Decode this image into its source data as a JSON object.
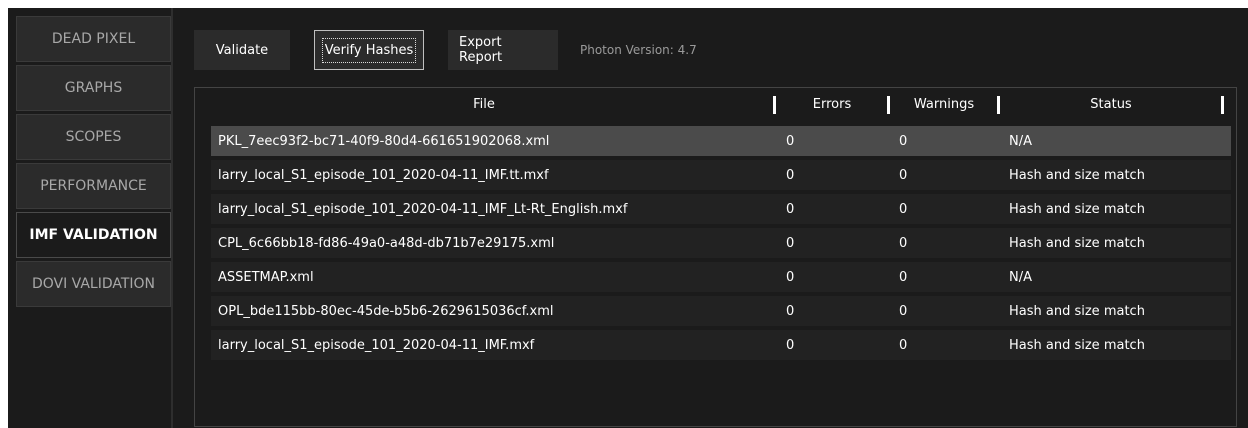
{
  "sidebar": {
    "tabs": [
      {
        "label": "DEAD PIXEL"
      },
      {
        "label": "GRAPHS"
      },
      {
        "label": "SCOPES"
      },
      {
        "label": "PERFORMANCE"
      },
      {
        "label": "IMF VALIDATION"
      },
      {
        "label": "DOVI VALIDATION"
      }
    ],
    "active_tab": "IMF VALIDATION"
  },
  "toolbar": {
    "validate_label": "Validate",
    "verify_hashes_label": "Verify Hashes",
    "export_report_label": "Export Report",
    "photon_version": "Photon Version: 4.7"
  },
  "table": {
    "columns": [
      "File",
      "Errors",
      "Warnings",
      "Status"
    ],
    "rows": [
      {
        "file": "PKL_7eec93f2-bc71-40f9-80d4-661651902068.xml",
        "errors": "0",
        "warnings": "0",
        "status": "N/A"
      },
      {
        "file": "larry_local_S1_episode_101_2020-04-11_IMF.tt.mxf",
        "errors": "0",
        "warnings": "0",
        "status": "Hash and size match"
      },
      {
        "file": "larry_local_S1_episode_101_2020-04-11_IMF_Lt-Rt_English.mxf",
        "errors": "0",
        "warnings": "0",
        "status": "Hash and size match"
      },
      {
        "file": "CPL_6c66bb18-fd86-49a0-a48d-db71b7e29175.xml",
        "errors": "0",
        "warnings": "0",
        "status": "Hash and size match"
      },
      {
        "file": "ASSETMAP.xml",
        "errors": "0",
        "warnings": "0",
        "status": "N/A"
      },
      {
        "file": "OPL_bde115bb-80ec-45de-b5b6-2629615036cf.xml",
        "errors": "0",
        "warnings": "0",
        "status": "Hash and size match"
      },
      {
        "file": "larry_local_S1_episode_101_2020-04-11_IMF.mxf",
        "errors": "0",
        "warnings": "0",
        "status": "Hash and size match"
      }
    ],
    "selected_row": 0
  },
  "colors": {
    "background": "#1b1b1b",
    "tab_inactive": "#2b2b2b",
    "row_selected": "#4b4b4b",
    "row": "#222222",
    "text": "#ffffff",
    "text_muted": "#a8a8a8"
  }
}
